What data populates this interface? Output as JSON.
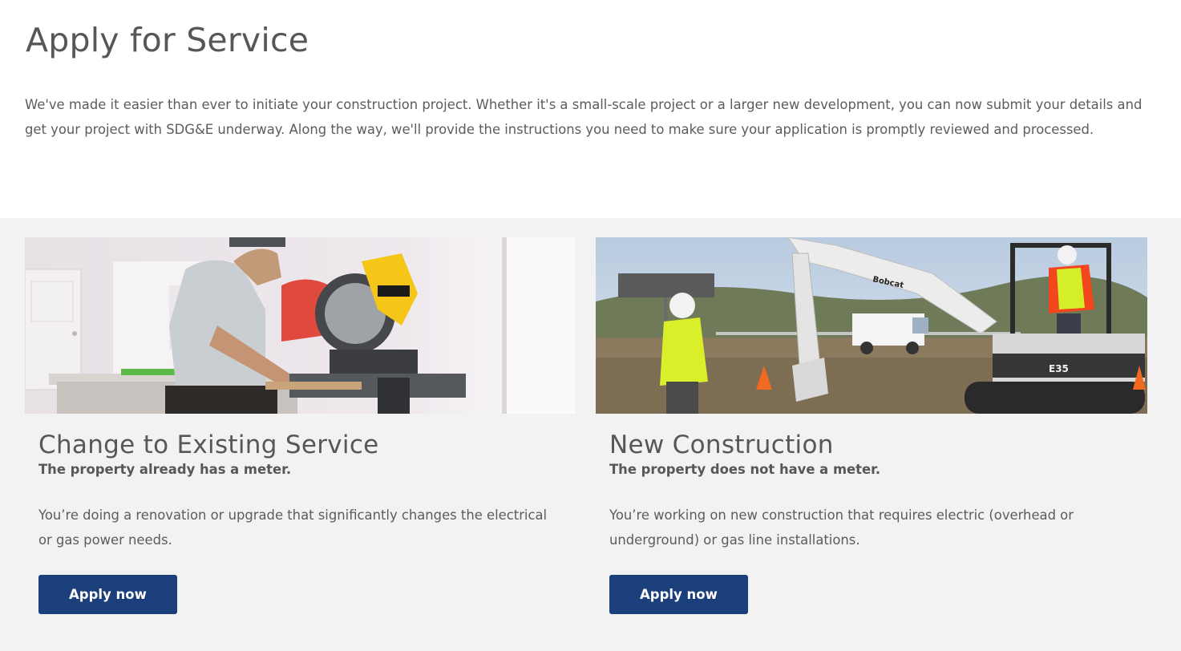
{
  "page": {
    "title": "Apply for Service",
    "intro": "We've made it easier than ever to initiate your construction project. Whether it's a small-scale project or a larger new development, you can now submit your details and get your project with SDG&E underway. Along the way, we'll provide the instructions you need to make sure your application is promptly reviewed and processed."
  },
  "cards": [
    {
      "title": "Change to Existing Service",
      "subtitle": "The property already has a meter.",
      "description": "You’re doing a renovation or upgrade that significantly changes the electrical or gas power needs.",
      "button_label": "Apply now",
      "image": "renovation-photo"
    },
    {
      "title": "New Construction",
      "subtitle": "The property does not have a meter.",
      "description": "You’re working on new construction that requires electric (overhead or underground) or gas line installations.",
      "button_label": "Apply now",
      "image": "excavator-photo",
      "image_text": {
        "brand": "Bobcat",
        "model": "E35"
      }
    }
  ],
  "colors": {
    "button_bg": "#1b3f7a",
    "section_bg": "#f2f2f2",
    "text": "#575757"
  }
}
